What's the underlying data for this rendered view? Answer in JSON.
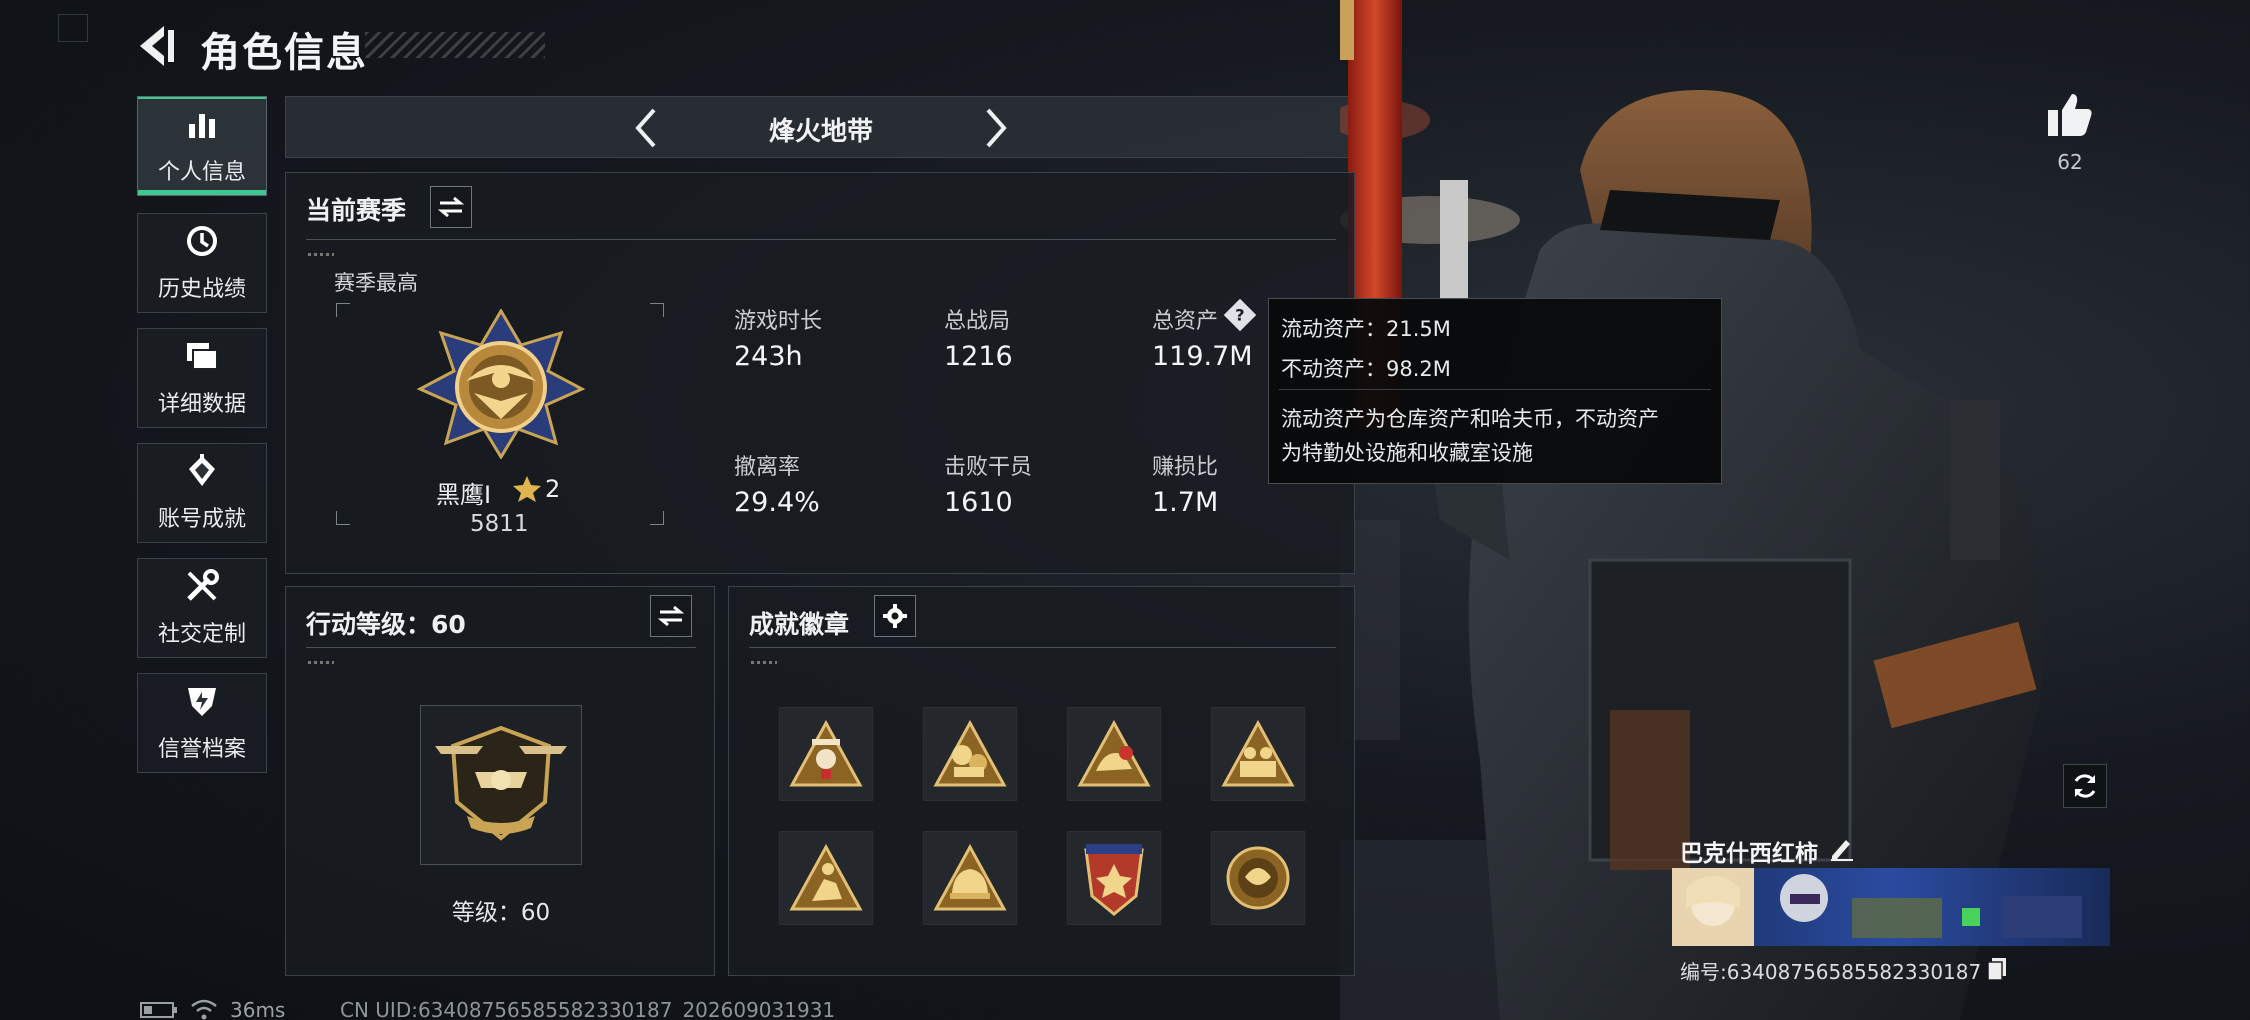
{
  "header": {
    "title": "角色信息"
  },
  "sidebar": {
    "items": [
      {
        "label": "个人信息",
        "icon": "bar-chart-icon",
        "active": true
      },
      {
        "label": "历史战绩",
        "icon": "history-icon",
        "active": false
      },
      {
        "label": "详细数据",
        "icon": "folder-icon",
        "active": false
      },
      {
        "label": "账号成就",
        "icon": "achievement-icon",
        "active": false
      },
      {
        "label": "社交定制",
        "icon": "tools-icon",
        "active": false
      },
      {
        "label": "信誉档案",
        "icon": "shield-icon",
        "active": false
      }
    ]
  },
  "mode": {
    "title": "烽火地带"
  },
  "season": {
    "title": "当前赛季",
    "highest_label": "赛季最高",
    "rank_name": "黑鹰I",
    "rank_stars": "2",
    "rank_score": "5811",
    "stats": [
      {
        "label": "游戏时长",
        "value": "243h"
      },
      {
        "label": "总战局",
        "value": "1216"
      },
      {
        "label": "总资产",
        "value": "119.7M"
      },
      {
        "label": "撤离率",
        "value": "29.4%"
      },
      {
        "label": "击败干员",
        "value": "1610"
      },
      {
        "label": "赚损比",
        "value": "1.7M"
      }
    ]
  },
  "tooltip": {
    "liquid": "流动资产：21.5M",
    "fixed": "不动资产：98.2M",
    "desc_line1": "流动资产为仓库资产和哈夫币，不动资产",
    "desc_line2": "为特勤处设施和收藏室设施"
  },
  "action_level": {
    "title": "行动等级：60",
    "level_text": "等级：60"
  },
  "badges": {
    "title": "成就徽章",
    "count": 8
  },
  "profile": {
    "likes": "62",
    "name": "巴克什西红柿",
    "card_uid": "编号:634087565855823301​87"
  },
  "footer": {
    "ping": "36ms",
    "uid": "CN UID:634087565855823301​87_202609031931"
  },
  "colors": {
    "accent": "#3cc88e",
    "gold": "#c9a454",
    "panel": "#181c21"
  }
}
